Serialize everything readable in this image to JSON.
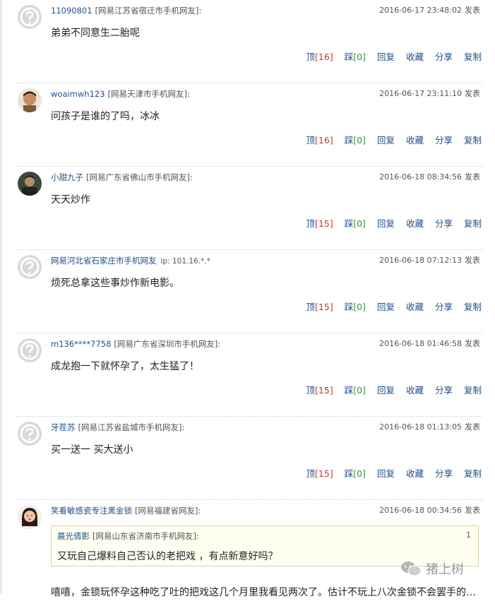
{
  "comments": [
    {
      "user": "11090801",
      "location": "[网易江苏省宿迁市手机网友]:",
      "ip": "",
      "time": "2016-06-17 23:48:02",
      "post_label": "发表",
      "body": "弟弟不同意生二胎呢",
      "avatar": "default",
      "actions": {
        "up": "顶",
        "up_count": "[16]",
        "down": "踩",
        "down_count": "[0]",
        "reply": "回复",
        "favorite": "收藏",
        "share": "分享",
        "copy": "复制"
      }
    },
    {
      "user": "woaimwh123",
      "location": "[网易天津市手机网友]:",
      "ip": "",
      "time": "2016-06-17 23:11:10",
      "post_label": "发表",
      "body": "问孩子是谁的了吗，冰冰",
      "avatar": "photo-man",
      "actions": {
        "up": "顶",
        "up_count": "[16]",
        "down": "踩",
        "down_count": "[0]",
        "reply": "回复",
        "favorite": "收藏",
        "share": "分享",
        "copy": "复制"
      }
    },
    {
      "user": "小甜九子",
      "location": "[网易广东省佛山市手机网友]:",
      "ip": "",
      "time": "2016-06-18 08:34:56",
      "post_label": "发表",
      "body": "天天炒作",
      "avatar": "photo-dark",
      "actions": {
        "up": "顶",
        "up_count": "[15]",
        "down": "踩",
        "down_count": "[0]",
        "reply": "回复",
        "favorite": "收藏",
        "share": "分享",
        "copy": "复制"
      }
    },
    {
      "user": "网易河北省石家庄市手机网友",
      "location": "",
      "ip": "ip: 101.16.*.*",
      "time": "2016-06-18 07:12:13",
      "post_label": "发表",
      "body": "烦死总拿这些事炒作新电影。",
      "avatar": "default",
      "actions": {
        "up": "顶",
        "up_count": "[15]",
        "down": "踩",
        "down_count": "[0]",
        "reply": "回复",
        "favorite": "收藏",
        "share": "分享",
        "copy": "复制"
      }
    },
    {
      "user": "m136****7758",
      "location": "[网易广东省深圳市手机网友]:",
      "ip": "",
      "time": "2016-06-18 01:46:58",
      "post_label": "发表",
      "body": "成龙抱一下就怀孕了，太生猛了！",
      "avatar": "default",
      "actions": {
        "up": "顶",
        "up_count": "[15]",
        "down": "踩",
        "down_count": "[0]",
        "reply": "回复",
        "favorite": "收藏",
        "share": "分享",
        "copy": "复制"
      }
    },
    {
      "user": "牙茬苏",
      "location": "[网易江苏省盐城市手机网友]:",
      "ip": "",
      "time": "2016-06-18 01:13:05",
      "post_label": "发表",
      "body": "买一送一  买大送小",
      "avatar": "default",
      "actions": {
        "up": "顶",
        "up_count": "[15]",
        "down": "踩",
        "down_count": "[0]",
        "reply": "回复",
        "favorite": "收藏",
        "share": "分享",
        "copy": "复制"
      }
    }
  ],
  "last_comment": {
    "user": "笑看敏感瓷专注黑金锁",
    "location": "[网易福建省网友]:",
    "time": "2016-06-18 00:34:56",
    "post_label": "发表",
    "avatar": "photo-girl",
    "quote": {
      "user": "晨光倩影",
      "location": "[网易山东省济南市手机网友]:",
      "num": "1",
      "body": "又玩自己爆料自己否认的老把戏 ，有点新意好吗？"
    },
    "body": "嘻嘻，金锁玩怀孕这种吃了吐的把戏这几个月里我看见两次了。估计不玩上八次金锁不会罢手的…"
  },
  "watermark": {
    "text": "猪上树"
  }
}
